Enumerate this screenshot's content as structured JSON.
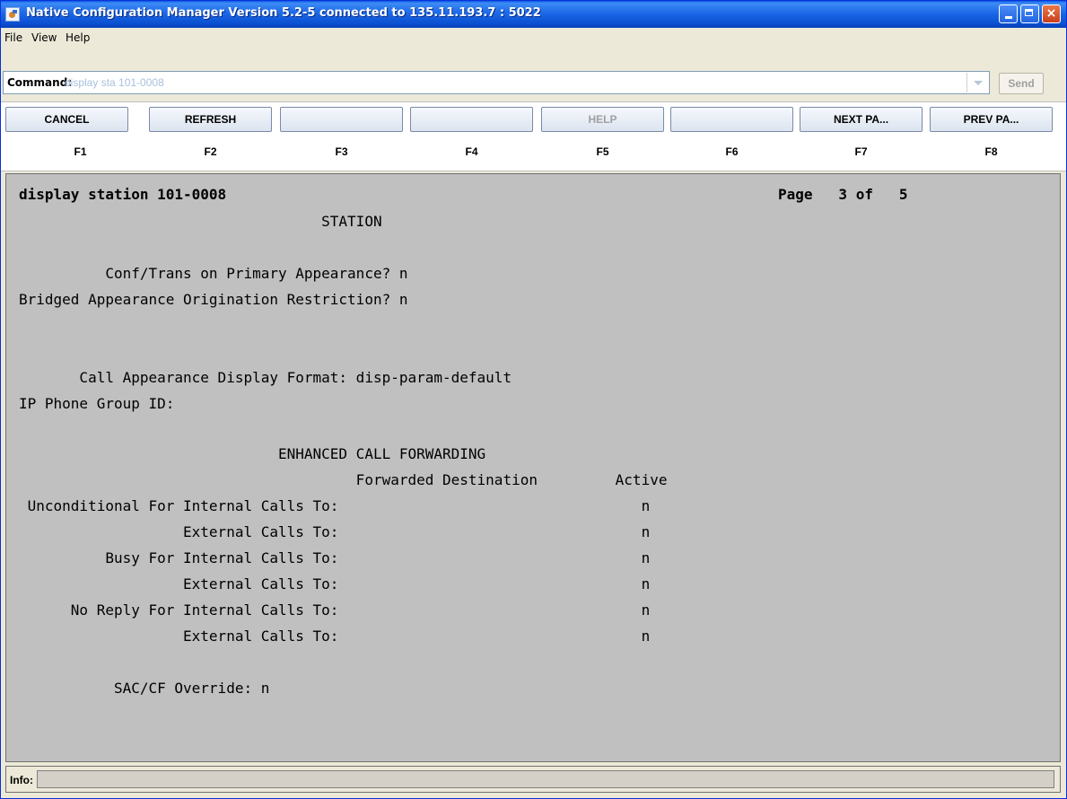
{
  "window": {
    "title": "Native Configuration Manager Version 5.2-5 connected to 135.11.193.7 : 5022",
    "minimize": "_",
    "maximize": "□",
    "close": "×"
  },
  "menu": [
    "File",
    "View",
    "Help"
  ],
  "command": {
    "label": "Command:",
    "value": "display sta 101-0008",
    "send_label": "Send"
  },
  "function_keys": [
    {
      "button": "CANCEL",
      "key": "F1",
      "enabled": true
    },
    {
      "button": "REFRESH",
      "key": "F2",
      "enabled": true
    },
    {
      "button": "",
      "key": "F3",
      "enabled": true
    },
    {
      "button": "",
      "key": "F4",
      "enabled": true
    },
    {
      "button": "HELP",
      "key": "F5",
      "enabled": false
    },
    {
      "button": "",
      "key": "F6",
      "enabled": true
    },
    {
      "button": "NEXT  PA...",
      "key": "F7",
      "enabled": true
    },
    {
      "button": "PREV  PA...",
      "key": "F8",
      "enabled": true
    }
  ],
  "screen": {
    "header_left": "display station 101-0008",
    "header_right": "Page   3 of   5",
    "lines": [
      "                                   STATION",
      "",
      "          Conf/Trans on Primary Appearance? n",
      "Bridged Appearance Origination Restriction? n",
      "",
      "",
      "       Call Appearance Display Format: disp-param-default",
      "IP Phone Group ID:",
      "",
      "                              ENHANCED CALL FORWARDING",
      "                                       Forwarded Destination         Active",
      " Unconditional For Internal Calls To:                                   n",
      "                   External Calls To:                                   n",
      "          Busy For Internal Calls To:                                   n",
      "                   External Calls To:                                   n",
      "      No Reply For Internal Calls To:                                   n",
      "                   External Calls To:                                   n",
      "",
      "           SAC/CF Override: n"
    ]
  },
  "info": {
    "label": "Info:",
    "value": ""
  }
}
